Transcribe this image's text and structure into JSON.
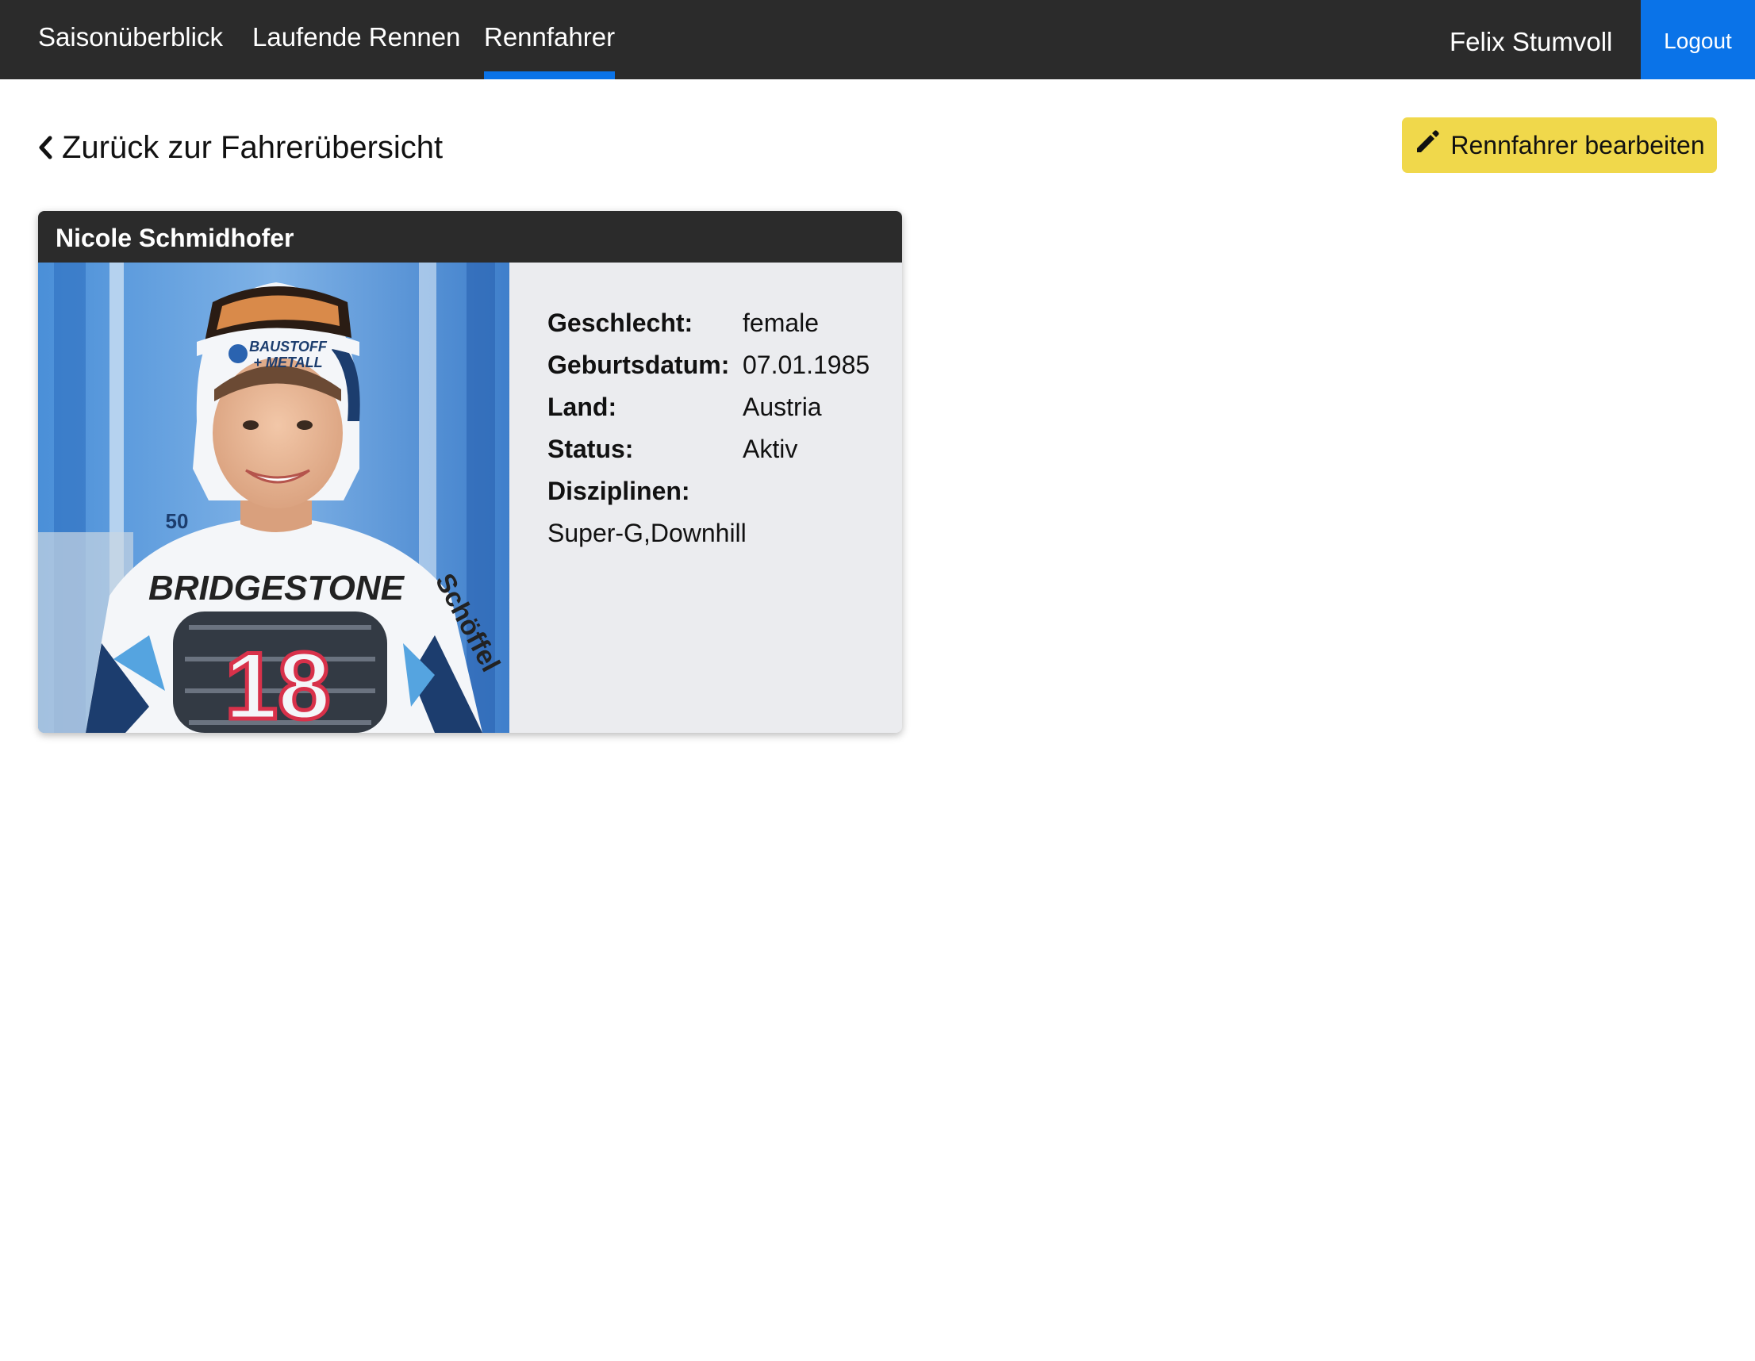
{
  "nav": {
    "items": [
      {
        "label": "Saisonüberblick"
      },
      {
        "label": "Laufende Rennen"
      },
      {
        "label": "Rennfahrer"
      }
    ],
    "active_index": 2,
    "user_name": "Felix Stumvoll",
    "logout_label": "Logout"
  },
  "page": {
    "back_label": "Zurück zur Fahrerübersicht",
    "edit_label": "Rennfahrer bearbeiten"
  },
  "driver": {
    "name": "Nicole Schmidhofer",
    "fields": {
      "gender": {
        "label": "Geschlecht:",
        "value": "female"
      },
      "birthdate": {
        "label": "Geburtsdatum:",
        "value": "07.01.1985"
      },
      "country": {
        "label": "Land:",
        "value": "Austria"
      },
      "status": {
        "label": "Status:",
        "value": "Aktiv"
      },
      "disciplines": {
        "label": "Disziplinen:",
        "value": "Super-G,Downhill"
      }
    },
    "photo": {
      "helmet_sponsor_line1": "BAUSTOFF",
      "helmet_sponsor_line2": "+ METALL",
      "bib_sponsor": "BRIDGESTONE",
      "bib_number": "18",
      "suit_brand": "Schöffel",
      "bib_badge_number": "50"
    }
  },
  "colors": {
    "navbar_bg": "#2b2b2b",
    "accent_blue": "#0a73e8",
    "edit_button": "#f0d84b",
    "card_body": "#ebecef"
  }
}
